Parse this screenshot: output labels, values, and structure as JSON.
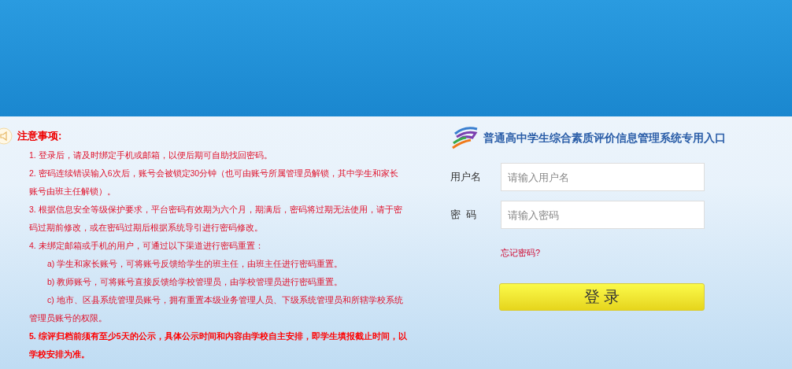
{
  "notice": {
    "title": "注意事项:",
    "items": [
      {
        "text": "1.  登录后，请及时绑定手机或邮箱，以便后期可自助找回密码。",
        "bold": false
      },
      {
        "text": "2.  密码连续错误输入6次后，账号会被锁定30分钟（也可由账号所属管理员解锁，其中学生和家长账号由班主任解锁）。",
        "bold": false
      },
      {
        "text": "3.  根据信息安全等级保护要求，平台密码有效期为六个月，期满后，密码将过期无法使用，请于密码过期前修改，或在密码过期后根据系统导引进行密码修改。",
        "bold": false
      },
      {
        "text": "4.  未绑定邮箱或手机的用户，可通过以下渠道进行密码重置：",
        "bold": false,
        "children": [
          {
            "text": "a)  学生和家长账号，可将账号反馈给学生的班主任，由班主任进行密码重置。"
          },
          {
            "text": "b)  教师账号，可将账号直接反馈给学校管理员，由学校管理员进行密码重置。"
          },
          {
            "text": "c)  地市、区县系统管理员账号，拥有重置本级业务管理人员、下级系统管理员和所辖学校系统管理员账号的权限。"
          }
        ]
      },
      {
        "text": "5.  综评归档前须有至少5天的公示，具体公示时间和内容由学校自主安排，即学生填报截止时间，以学校安排为准。",
        "bold": true
      }
    ]
  },
  "login": {
    "title": "普通高中学生综合素质评价信息管理系统专用入口",
    "fields": [
      {
        "label": "用户名",
        "placeholder": "请输入用户名"
      },
      {
        "label": "密  码",
        "placeholder": "请输入密码"
      }
    ],
    "forgot": "忘记密码?",
    "submit": "登 录"
  }
}
